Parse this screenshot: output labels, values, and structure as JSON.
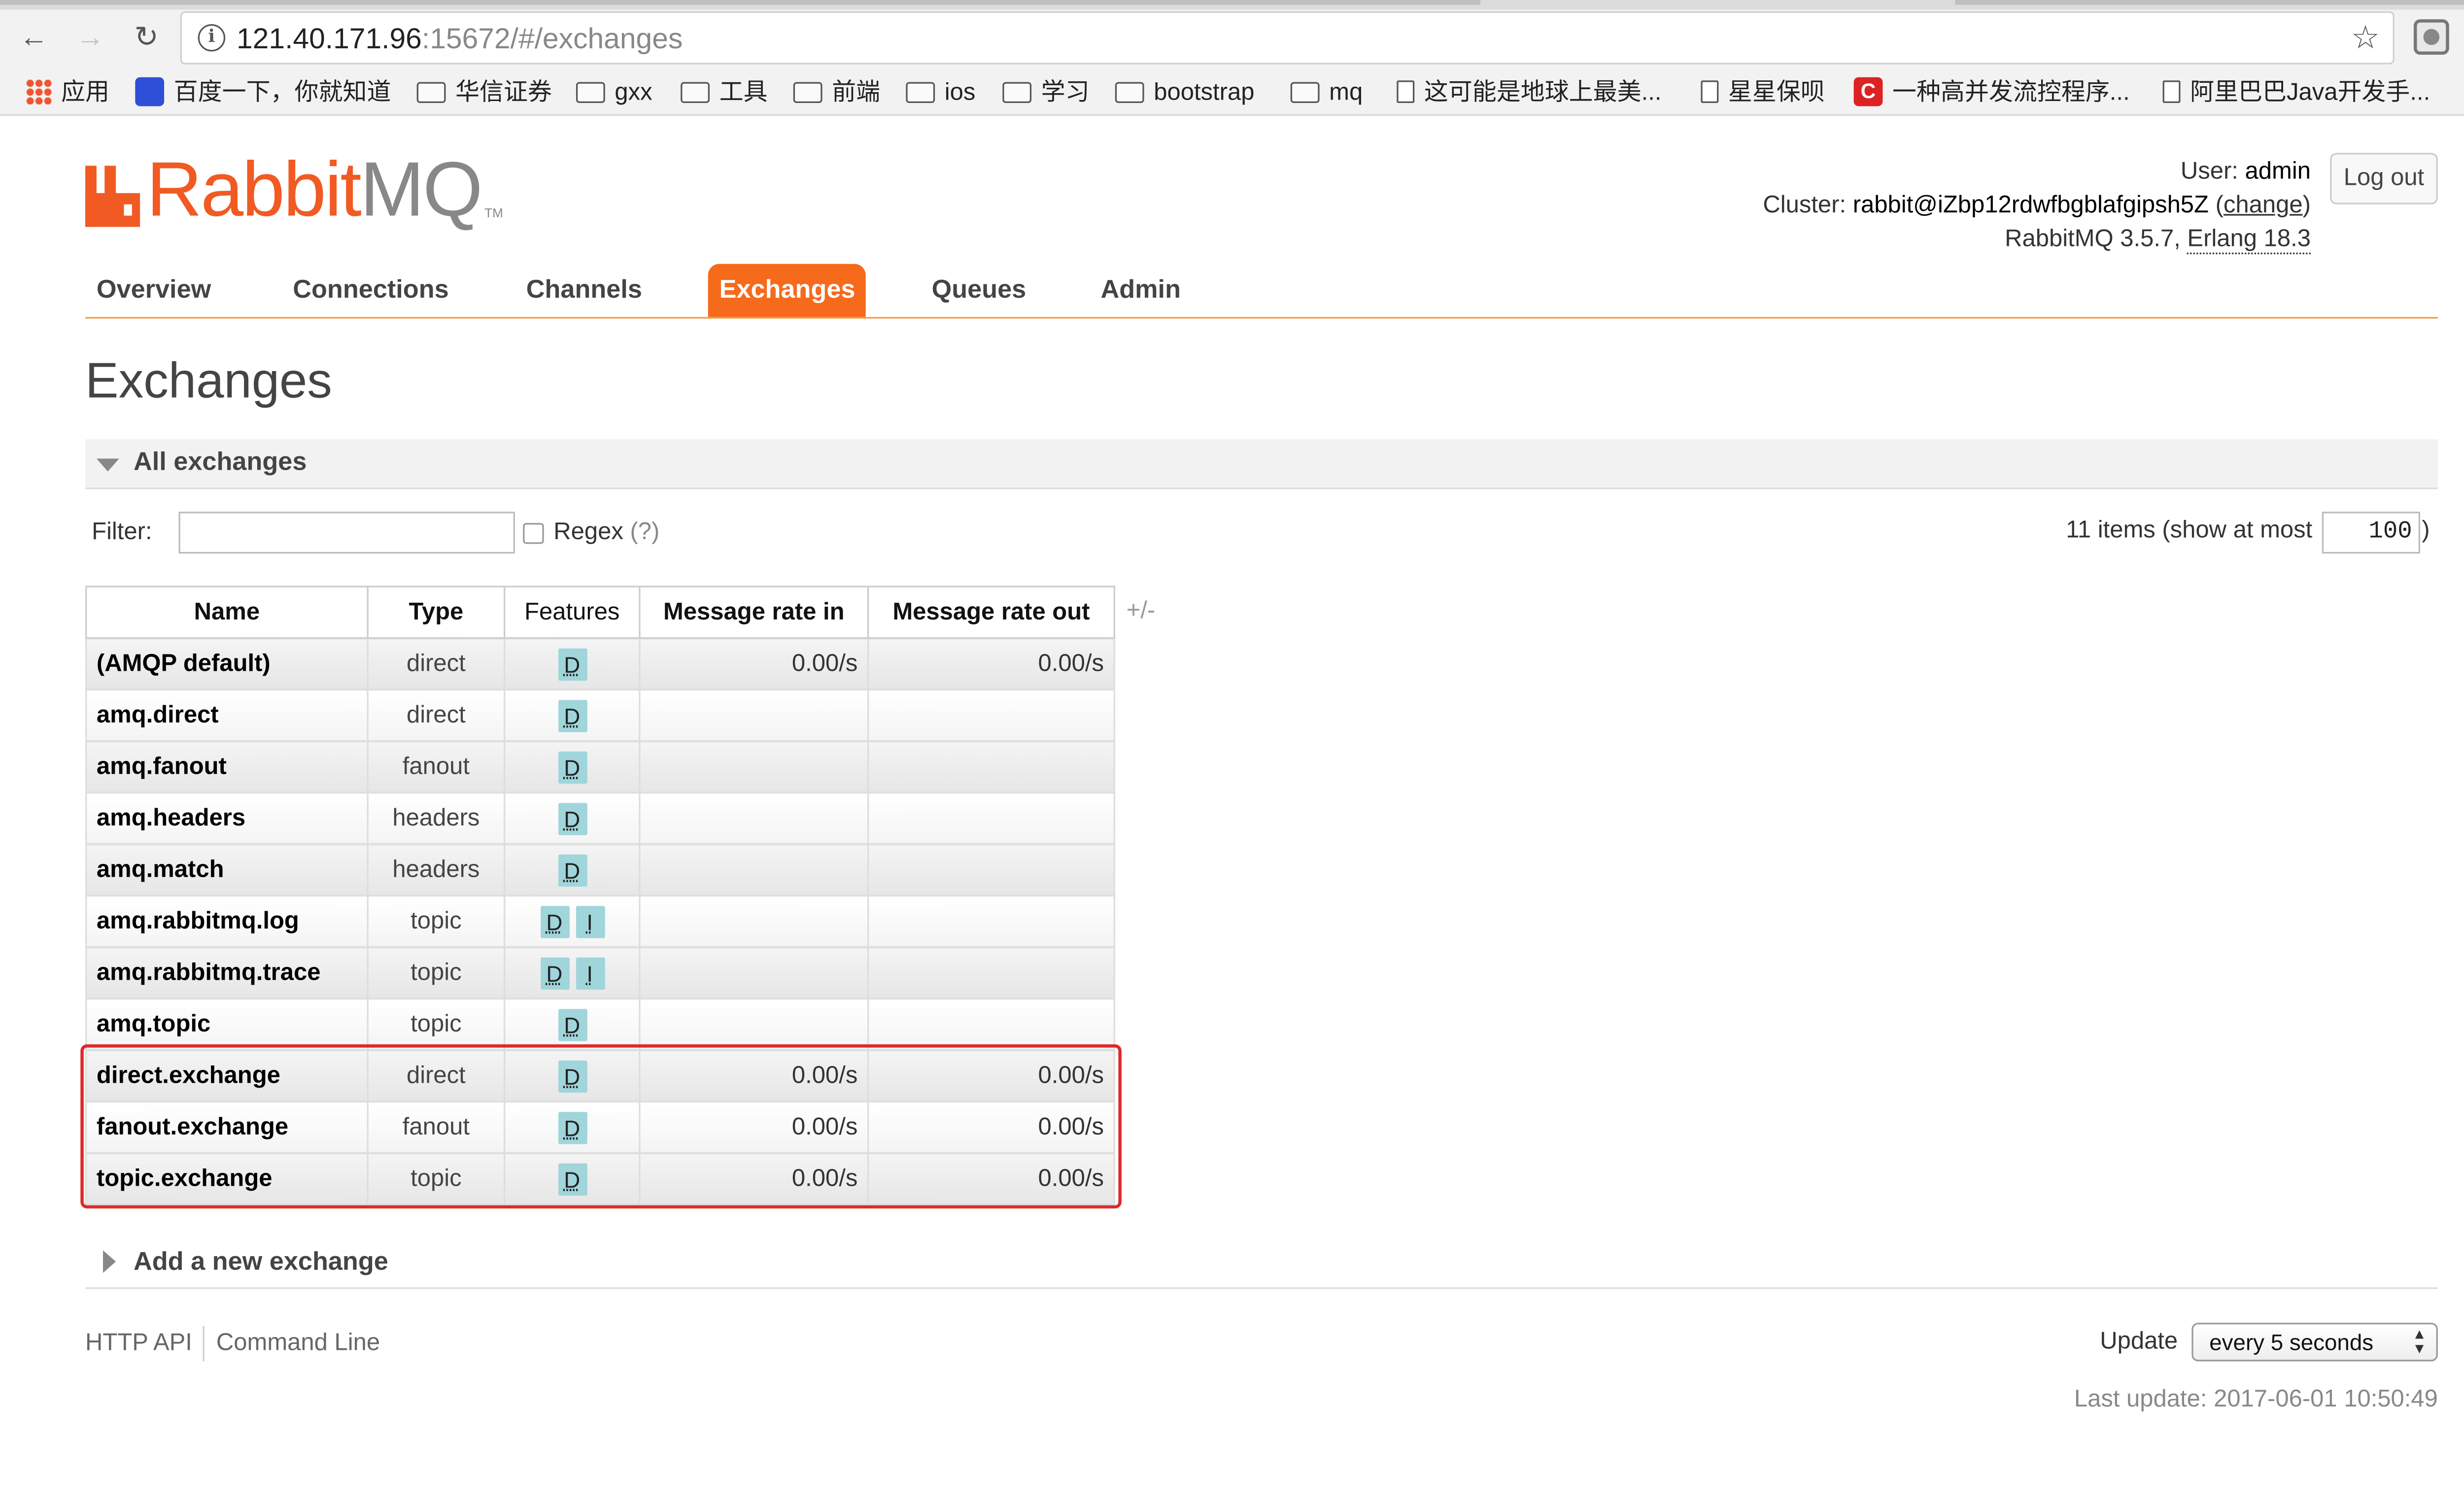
{
  "browser": {
    "url_host": "121.40.171.96",
    "url_rest": ":15672/#/exchanges",
    "bookmarks": [
      {
        "label": "应用",
        "icon": "apps-icon"
      },
      {
        "label": "百度一下，你就知道",
        "icon": "baidu-icon"
      },
      {
        "label": "华信证券",
        "icon": "folder-icon"
      },
      {
        "label": "gxx",
        "icon": "folder-icon"
      },
      {
        "label": "工具",
        "icon": "folder-icon"
      },
      {
        "label": "前端",
        "icon": "folder-icon"
      },
      {
        "label": "ios",
        "icon": "folder-icon"
      },
      {
        "label": "学习",
        "icon": "folder-icon"
      },
      {
        "label": "bootstrap",
        "icon": "folder-icon"
      },
      {
        "label": "mq",
        "icon": "folder-icon"
      },
      {
        "label": "这可能是地球上最美...",
        "icon": "page-icon"
      },
      {
        "label": "星星保呗",
        "icon": "page-icon"
      },
      {
        "label": "一种高并发流控程序...",
        "icon": "csdn-icon"
      },
      {
        "label": "阿里巴巴Java开发手...",
        "icon": "page-icon"
      }
    ],
    "bookmarks_more": "»"
  },
  "logo": {
    "rabbit": "Rabbit",
    "mq": "MQ",
    "tm": "TM"
  },
  "login": {
    "user_label": "User:",
    "user": "admin",
    "cluster_label": "Cluster:",
    "cluster": "rabbit@iZbp12rdwfbgblafgipsh5Z",
    "change": "change",
    "version": "RabbitMQ 3.5.7,",
    "erlang": "Erlang 18.3",
    "logout": "Log out"
  },
  "tabs": [
    "Overview",
    "Connections",
    "Channels",
    "Exchanges",
    "Queues",
    "Admin"
  ],
  "page_title": "Exchanges",
  "section_all": "All exchanges",
  "filter": {
    "label": "Filter:",
    "value": "",
    "regex_label": "Regex",
    "regex_help": "(?)",
    "items_text": "11 items (show at most",
    "max": "100",
    "close_paren": ")"
  },
  "table": {
    "headers": [
      "Name",
      "Type",
      "Features",
      "Message rate in",
      "Message rate out"
    ],
    "toggle_columns": "+/-",
    "rows": [
      {
        "name": "(AMQP default)",
        "type": "direct",
        "features": [
          "D"
        ],
        "rate_in": "0.00/s",
        "rate_out": "0.00/s"
      },
      {
        "name": "amq.direct",
        "type": "direct",
        "features": [
          "D"
        ],
        "rate_in": "",
        "rate_out": ""
      },
      {
        "name": "amq.fanout",
        "type": "fanout",
        "features": [
          "D"
        ],
        "rate_in": "",
        "rate_out": ""
      },
      {
        "name": "amq.headers",
        "type": "headers",
        "features": [
          "D"
        ],
        "rate_in": "",
        "rate_out": ""
      },
      {
        "name": "amq.match",
        "type": "headers",
        "features": [
          "D"
        ],
        "rate_in": "",
        "rate_out": ""
      },
      {
        "name": "amq.rabbitmq.log",
        "type": "topic",
        "features": [
          "D",
          "I"
        ],
        "rate_in": "",
        "rate_out": ""
      },
      {
        "name": "amq.rabbitmq.trace",
        "type": "topic",
        "features": [
          "D",
          "I"
        ],
        "rate_in": "",
        "rate_out": ""
      },
      {
        "name": "amq.topic",
        "type": "topic",
        "features": [
          "D"
        ],
        "rate_in": "",
        "rate_out": ""
      },
      {
        "name": "direct.exchange",
        "type": "direct",
        "features": [
          "D"
        ],
        "rate_in": "0.00/s",
        "rate_out": "0.00/s"
      },
      {
        "name": "fanout.exchange",
        "type": "fanout",
        "features": [
          "D"
        ],
        "rate_in": "0.00/s",
        "rate_out": "0.00/s"
      },
      {
        "name": "topic.exchange",
        "type": "topic",
        "features": [
          "D"
        ],
        "rate_in": "0.00/s",
        "rate_out": "0.00/s"
      }
    ]
  },
  "section_add": "Add a new exchange",
  "footer": {
    "http_api": "HTTP API",
    "command_line": "Command Line",
    "update_label": "Update",
    "update_value": "every 5 seconds",
    "last_update": "Last update: 2017-06-01 10:50:49"
  },
  "colors": {
    "accent": "#f66a1c",
    "highlight": "#dd2a2a",
    "badge": "#9fd5db"
  }
}
